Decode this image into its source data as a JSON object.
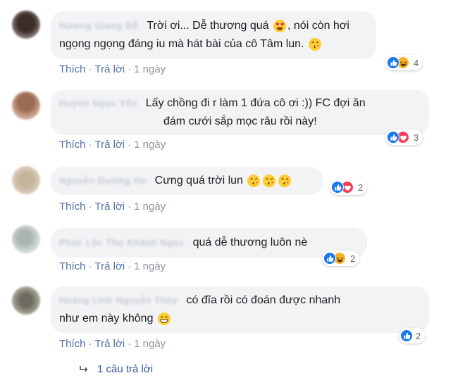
{
  "comments": [
    {
      "lines": [
        "Trời ơi... Dễ thương quá",
        ", nói còn hơi",
        "ngọng ngọng đáng iu mà hát bài của cô Tâm lun."
      ],
      "like_label": "Thích",
      "reply_label": "Trả lời",
      "time": "1 ngày",
      "reaction_count": "4"
    },
    {
      "lines": [
        "Lấy chồng đi r làm 1 đứa cô ơi :)) FC đợi ăn",
        "đám cưới sắp mọc râu rồi này!"
      ],
      "like_label": "Thích",
      "reply_label": "Trả lời",
      "time": "1 ngày",
      "reaction_count": "3"
    },
    {
      "lines": [
        "Cưng quá trời lun"
      ],
      "like_label": "Thích",
      "reply_label": "Trả lời",
      "time": "1 ngày",
      "reaction_count": "2"
    },
    {
      "lines": [
        "quá dễ thương luôn nè"
      ],
      "like_label": "Thích",
      "reply_label": "Trả lời",
      "time": "1 ngày",
      "reaction_count": "2"
    },
    {
      "lines": [
        "có đĩa rồi có đoán được nhanh",
        "như em này không"
      ],
      "like_label": "Thích",
      "reply_label": "Trả lời",
      "time": "1 ngày",
      "reaction_count": "2"
    }
  ],
  "replies_link": {
    "label": "1 câu trả lời"
  },
  "colors": {
    "like": "#1877f2",
    "haha": "#f7b125",
    "love": "#f33e58",
    "bubble": "#f2f3f5",
    "link": "#365899"
  },
  "icons": [
    "heart-eyes-emoji",
    "kiss-emoji",
    "grin-emoji",
    "like-reaction-icon",
    "haha-reaction-icon",
    "love-reaction-icon",
    "reply-arrow-icon"
  ]
}
